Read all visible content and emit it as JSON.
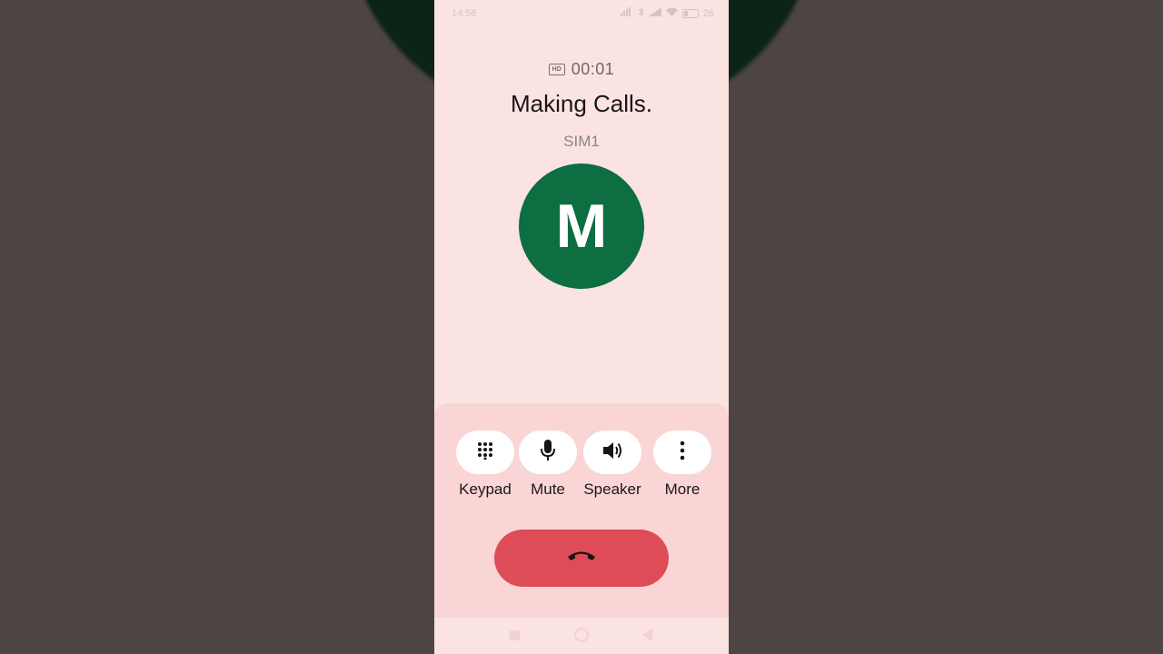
{
  "status_bar": {
    "time": "14:56",
    "battery": "26"
  },
  "call": {
    "timer": "00:01",
    "hd_badge": "HD",
    "caller_name": "Making Calls.",
    "sim": "SIM1",
    "avatar_letter": "M",
    "avatar_color": "#0d6e41"
  },
  "controls": [
    {
      "label": "Keypad",
      "icon": "dialpad-icon"
    },
    {
      "label": "Mute",
      "icon": "microphone-icon"
    },
    {
      "label": "Speaker",
      "icon": "speaker-icon"
    },
    {
      "label": "More",
      "icon": "more-vert-icon"
    }
  ],
  "end_call": {
    "icon": "call-end-icon",
    "color": "#de4c58"
  },
  "nav": {
    "items": [
      "recents-icon",
      "home-icon",
      "back-icon"
    ]
  }
}
